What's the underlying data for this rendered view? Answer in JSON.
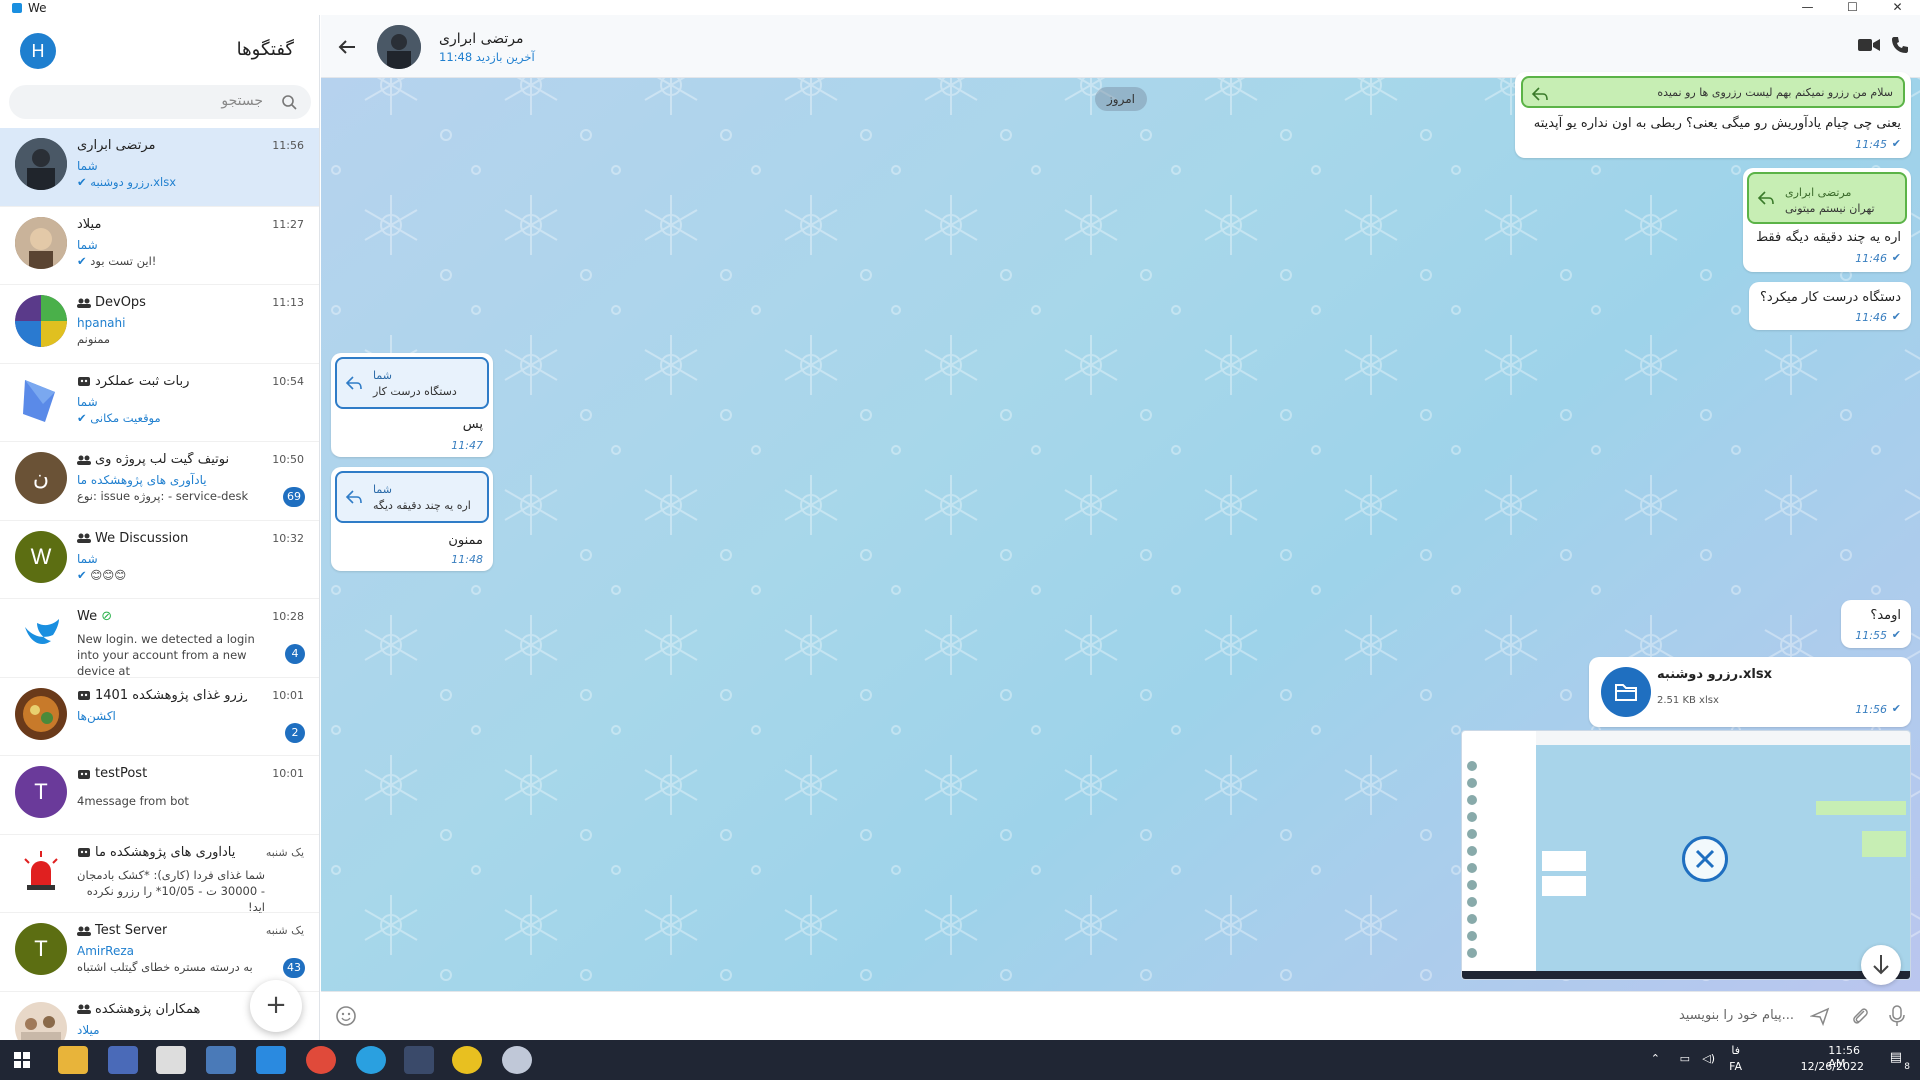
{
  "window": {
    "title": "We",
    "minimize": "—",
    "maximize": "☐",
    "close": "✕"
  },
  "sidebar": {
    "title": "گفتگوها",
    "user_initial": "H",
    "search_placeholder": "جستجو",
    "new_button": "+",
    "chats": [
      {
        "name": "مرتضی ابراری",
        "time": "11:56",
        "sender": "شما",
        "message": "رزرو دوشنبه.xlsx",
        "badge": ""
      },
      {
        "name": "میلاد",
        "time": "11:27",
        "sender": "شما",
        "message": "این تست بود!",
        "badge": ""
      },
      {
        "name": "DevOps",
        "time": "11:13",
        "sender": "hpanahi",
        "message": "ممنونم",
        "badge": ""
      },
      {
        "name": "ربات ثبت عملکرد",
        "time": "10:54",
        "sender": "شما",
        "message": "موقعیت مکانی",
        "badge": ""
      },
      {
        "name": "نوتیف گیت لب پروژه وی",
        "time": "10:50",
        "sender": "یادآوری های پژوهشکده ما",
        "message": "نوع: issue پروژه: - service-desk",
        "badge": "69",
        "initial": "ن"
      },
      {
        "name": "We Discussion",
        "time": "10:32",
        "sender": "شما",
        "message": "😊😊😊",
        "badge": "",
        "initial": "W"
      },
      {
        "name": "We",
        "time": "10:28",
        "sender": "",
        "message": "New login. we detected a login into your account from a new device at",
        "badge": "4"
      },
      {
        "name": "رزرو غذای پژوهشکده 1401",
        "time": "10:01",
        "sender": "اکشن‌ها",
        "message": "",
        "badge": "2"
      },
      {
        "name": "testPost",
        "time": "10:01",
        "sender": "",
        "message": "4message from bot",
        "badge": "",
        "initial": "T"
      },
      {
        "name": "یادآوری های پژوهشکده ما",
        "time": "یک شنبه",
        "sender": "",
        "message": "شما غذای فردا (کاری): *کشک بادمجان - 30000 ت - 10/05* را رزرو نکرده اید!",
        "badge": ""
      },
      {
        "name": "Test Server",
        "time": "یک شنبه",
        "sender": "AmirReza",
        "message": "به درسته مستره خطای گیتلب اشتباه",
        "badge": "43",
        "initial": "T"
      },
      {
        "name": "همکاران پژوهشکده",
        "time": "",
        "sender": "میلاد",
        "message": "",
        "badge": ""
      }
    ]
  },
  "conversation": {
    "name": "مرتضی ابراری",
    "status": "آخرین بازدید 11:48",
    "date_chip": "امروز",
    "messages": [
      {
        "reply_text": "سلام من رزرو نمیکنم بهم لیست رزروی ها رو نمیده",
        "text": "یعنی چی چیام یادآوریش رو میگی یعنی؟ ربطی به اون نداره یو آپدیته",
        "time": "11:45"
      },
      {
        "reply_name": "مرتضی ابراری",
        "reply_text": "تهران نیستم میتونی",
        "text": "اره یه چند دقیقه دیگه فقط",
        "time": "11:46"
      },
      {
        "text": "دستگاه درست کار میکرد؟",
        "time": "11:46"
      },
      {
        "reply_name": "شما",
        "reply_text": "دستگاه درست کار",
        "text": "پس",
        "time": "11:47"
      },
      {
        "reply_name": "شما",
        "reply_text": "اره یه چند دقیقه دیگه",
        "text": "ممنون",
        "time": "11:48"
      },
      {
        "text": "اومد؟",
        "time": "11:55"
      },
      {
        "file_name": "رزرو دوشنبه.xlsx",
        "file_meta": "2.51 KB  xlsx",
        "time": "11:56"
      }
    ],
    "composer_placeholder": "پیام خود را بنویسید..."
  },
  "taskbar": {
    "time": "11:56 AM",
    "date": "12/26/2022",
    "lang": "FA",
    "lang2": "فا",
    "notif": "8"
  }
}
